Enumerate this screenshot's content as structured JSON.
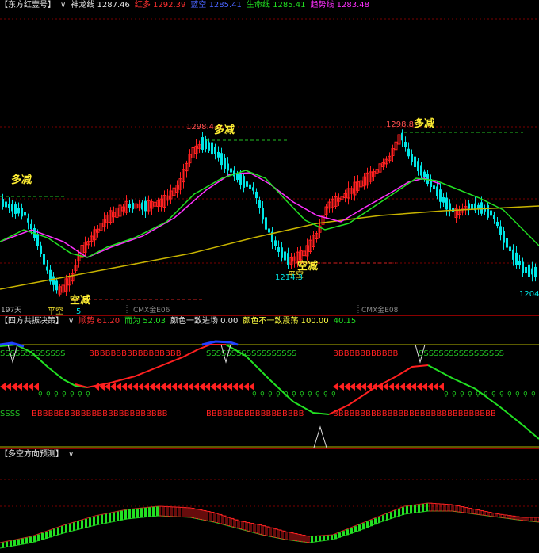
{
  "panel1": {
    "title": "【东方红壹号】",
    "chevron": "∨",
    "indicators": [
      {
        "label": "神龙线",
        "value": "1287.46",
        "color": "#e8e8e8"
      },
      {
        "label": "红多",
        "value": "1292.39",
        "color": "#ff3030"
      },
      {
        "label": "蓝空",
        "value": "1285.41",
        "color": "#4a64ff"
      },
      {
        "label": "生命线",
        "value": "1285.41",
        "color": "#22e022"
      },
      {
        "label": "趋势线",
        "value": "1283.48",
        "color": "#ff30ff"
      }
    ],
    "annotations": {
      "duo_jian_1": "多减",
      "duo_jian_2": "多减",
      "duo_jian_3": "多减",
      "kong_jian_1": "空减",
      "kong_jian_2": "空减",
      "ping_kong_1": "平空",
      "ping_kong_2": "平空",
      "price_high_1": "1298.4",
      "price_high_2": "1298.8",
      "price_low_1": "1214.3",
      "price_low_2": "1204.",
      "price_low_3": "5",
      "days": "197天",
      "contract_1": "CMX金E06",
      "contract_2": "CMX金E08"
    },
    "colors": {
      "up": "#ff2020",
      "down": "#00e5e5",
      "green": "#22e022",
      "magenta": "#ff30ff",
      "yellow": "#c8b400"
    }
  },
  "panel2": {
    "title": "【四方共振决策】",
    "chevron": "∨",
    "indicators": [
      {
        "label": "顺势",
        "value": "61.20",
        "color": "#ff3030"
      },
      {
        "label": "而为",
        "value": "52.03",
        "color": "#22e022"
      },
      {
        "label": "颜色一致进场",
        "value": "0.00",
        "color": "#e8e8e8"
      },
      {
        "label": "颜色不一致震荡",
        "value": "100.00",
        "color": "#ffff40"
      },
      {
        "label": "",
        "value": "40.15",
        "color": "#22e022"
      }
    ],
    "b_char": "B",
    "s_char": "S"
  },
  "panel3": {
    "title": "【多空方向预测】",
    "chevron": "∨"
  }
}
